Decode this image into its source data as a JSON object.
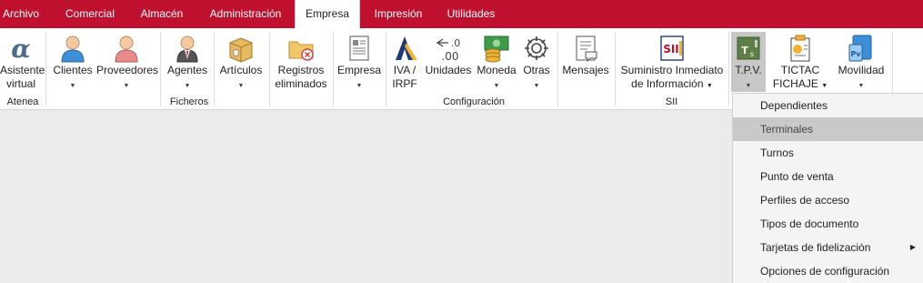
{
  "menubar": {
    "tabs": [
      {
        "label": "Archivo"
      },
      {
        "label": "Comercial"
      },
      {
        "label": "Almacén"
      },
      {
        "label": "Administración"
      },
      {
        "label": "Empresa",
        "active": true
      },
      {
        "label": "Impresión"
      },
      {
        "label": "Utilidades"
      }
    ]
  },
  "ribbon": {
    "asistente": {
      "line1": "Asistente",
      "line2": "virtual",
      "icon": "atenea-alpha-icon"
    },
    "clientes": {
      "label": "Clientes",
      "icon": "client-person-icon"
    },
    "proveedores": {
      "label": "Proveedores",
      "icon": "supplier-person-icon"
    },
    "agentes": {
      "label": "Agentes",
      "icon": "agent-person-icon"
    },
    "articulos": {
      "label": "Artículos",
      "icon": "box-icon"
    },
    "registros": {
      "line1": "Registros",
      "line2": "eliminados",
      "icon": "deleted-folder-icon"
    },
    "empresa": {
      "label": "Empresa",
      "icon": "company-document-icon"
    },
    "iva": {
      "line1": "IVA /",
      "line2": "IRPF",
      "icon": "tax-agency-icon"
    },
    "unidades": {
      "label": "Unidades",
      "icon": "decimal-units-icon"
    },
    "moneda": {
      "label": "Moneda",
      "icon": "currency-icon"
    },
    "otras": {
      "label": "Otras",
      "icon": "gear-icon"
    },
    "mensajes": {
      "label": "Mensajes",
      "icon": "messages-icon"
    },
    "sii": {
      "line1": "Suministro Inmediato",
      "line2": "de Información",
      "icon": "sii-icon"
    },
    "tpv": {
      "label": "T.P.V.",
      "icon": "tpv-icon"
    },
    "tictac": {
      "line1": "TICTAC",
      "line2": "FICHAJE",
      "icon": "tictac-clipboard-icon"
    },
    "movilidad": {
      "label": "Movilidad",
      "icon": "mobility-icon"
    },
    "groups": {
      "atenea": "Atenea",
      "ficheros": "Ficheros",
      "configuracion": "Configuración",
      "sii": "SII"
    }
  },
  "dropdown": {
    "items": [
      {
        "label": "Dependientes"
      },
      {
        "label": "Terminales",
        "highlighted": true
      },
      {
        "label": "Turnos"
      },
      {
        "label": "Punto de venta"
      },
      {
        "label": "Perfiles de acceso"
      },
      {
        "label": "Tipos de documento"
      },
      {
        "label": "Tarjetas de fidelización",
        "submenu": true
      },
      {
        "label": "Opciones de configuración"
      }
    ],
    "submenu_arrow": "▶"
  },
  "colors": {
    "menubar": "#c0102f",
    "ribbon": "#ffffff",
    "workspace": "#ebebeb",
    "dropdown": "#f4f4f4",
    "highlight": "#c9c9c9"
  }
}
